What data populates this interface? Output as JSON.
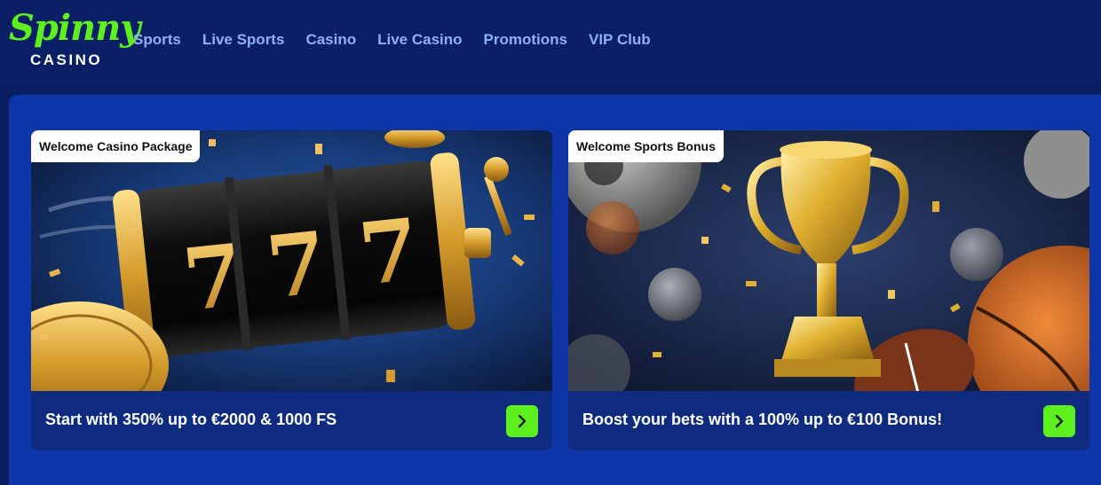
{
  "brand": {
    "name": "Spinny",
    "sub": "CASINO",
    "color": "#5ef01e"
  },
  "nav": {
    "items": [
      {
        "label": "Sports"
      },
      {
        "label": "Live Sports"
      },
      {
        "label": "Casino"
      },
      {
        "label": "Live Casino"
      },
      {
        "label": "Promotions"
      },
      {
        "label": "VIP Club"
      }
    ]
  },
  "cards": [
    {
      "tag": "Welcome Casino Package",
      "text": "Start with 350% up to €2000 & 1000 FS",
      "image": "slot-machine-777",
      "button_icon": "chevron-right-icon"
    },
    {
      "tag": "Welcome Sports Bonus",
      "text": "Boost your bets with a 100% up to €100 Bonus!",
      "image": "golden-trophy-sports-balls",
      "button_icon": "chevron-right-icon"
    }
  ],
  "colors": {
    "accent": "#5ef01e",
    "header": "#0b1f66",
    "panel": "#0f36a8",
    "nav_text": "#8fb0f0"
  }
}
